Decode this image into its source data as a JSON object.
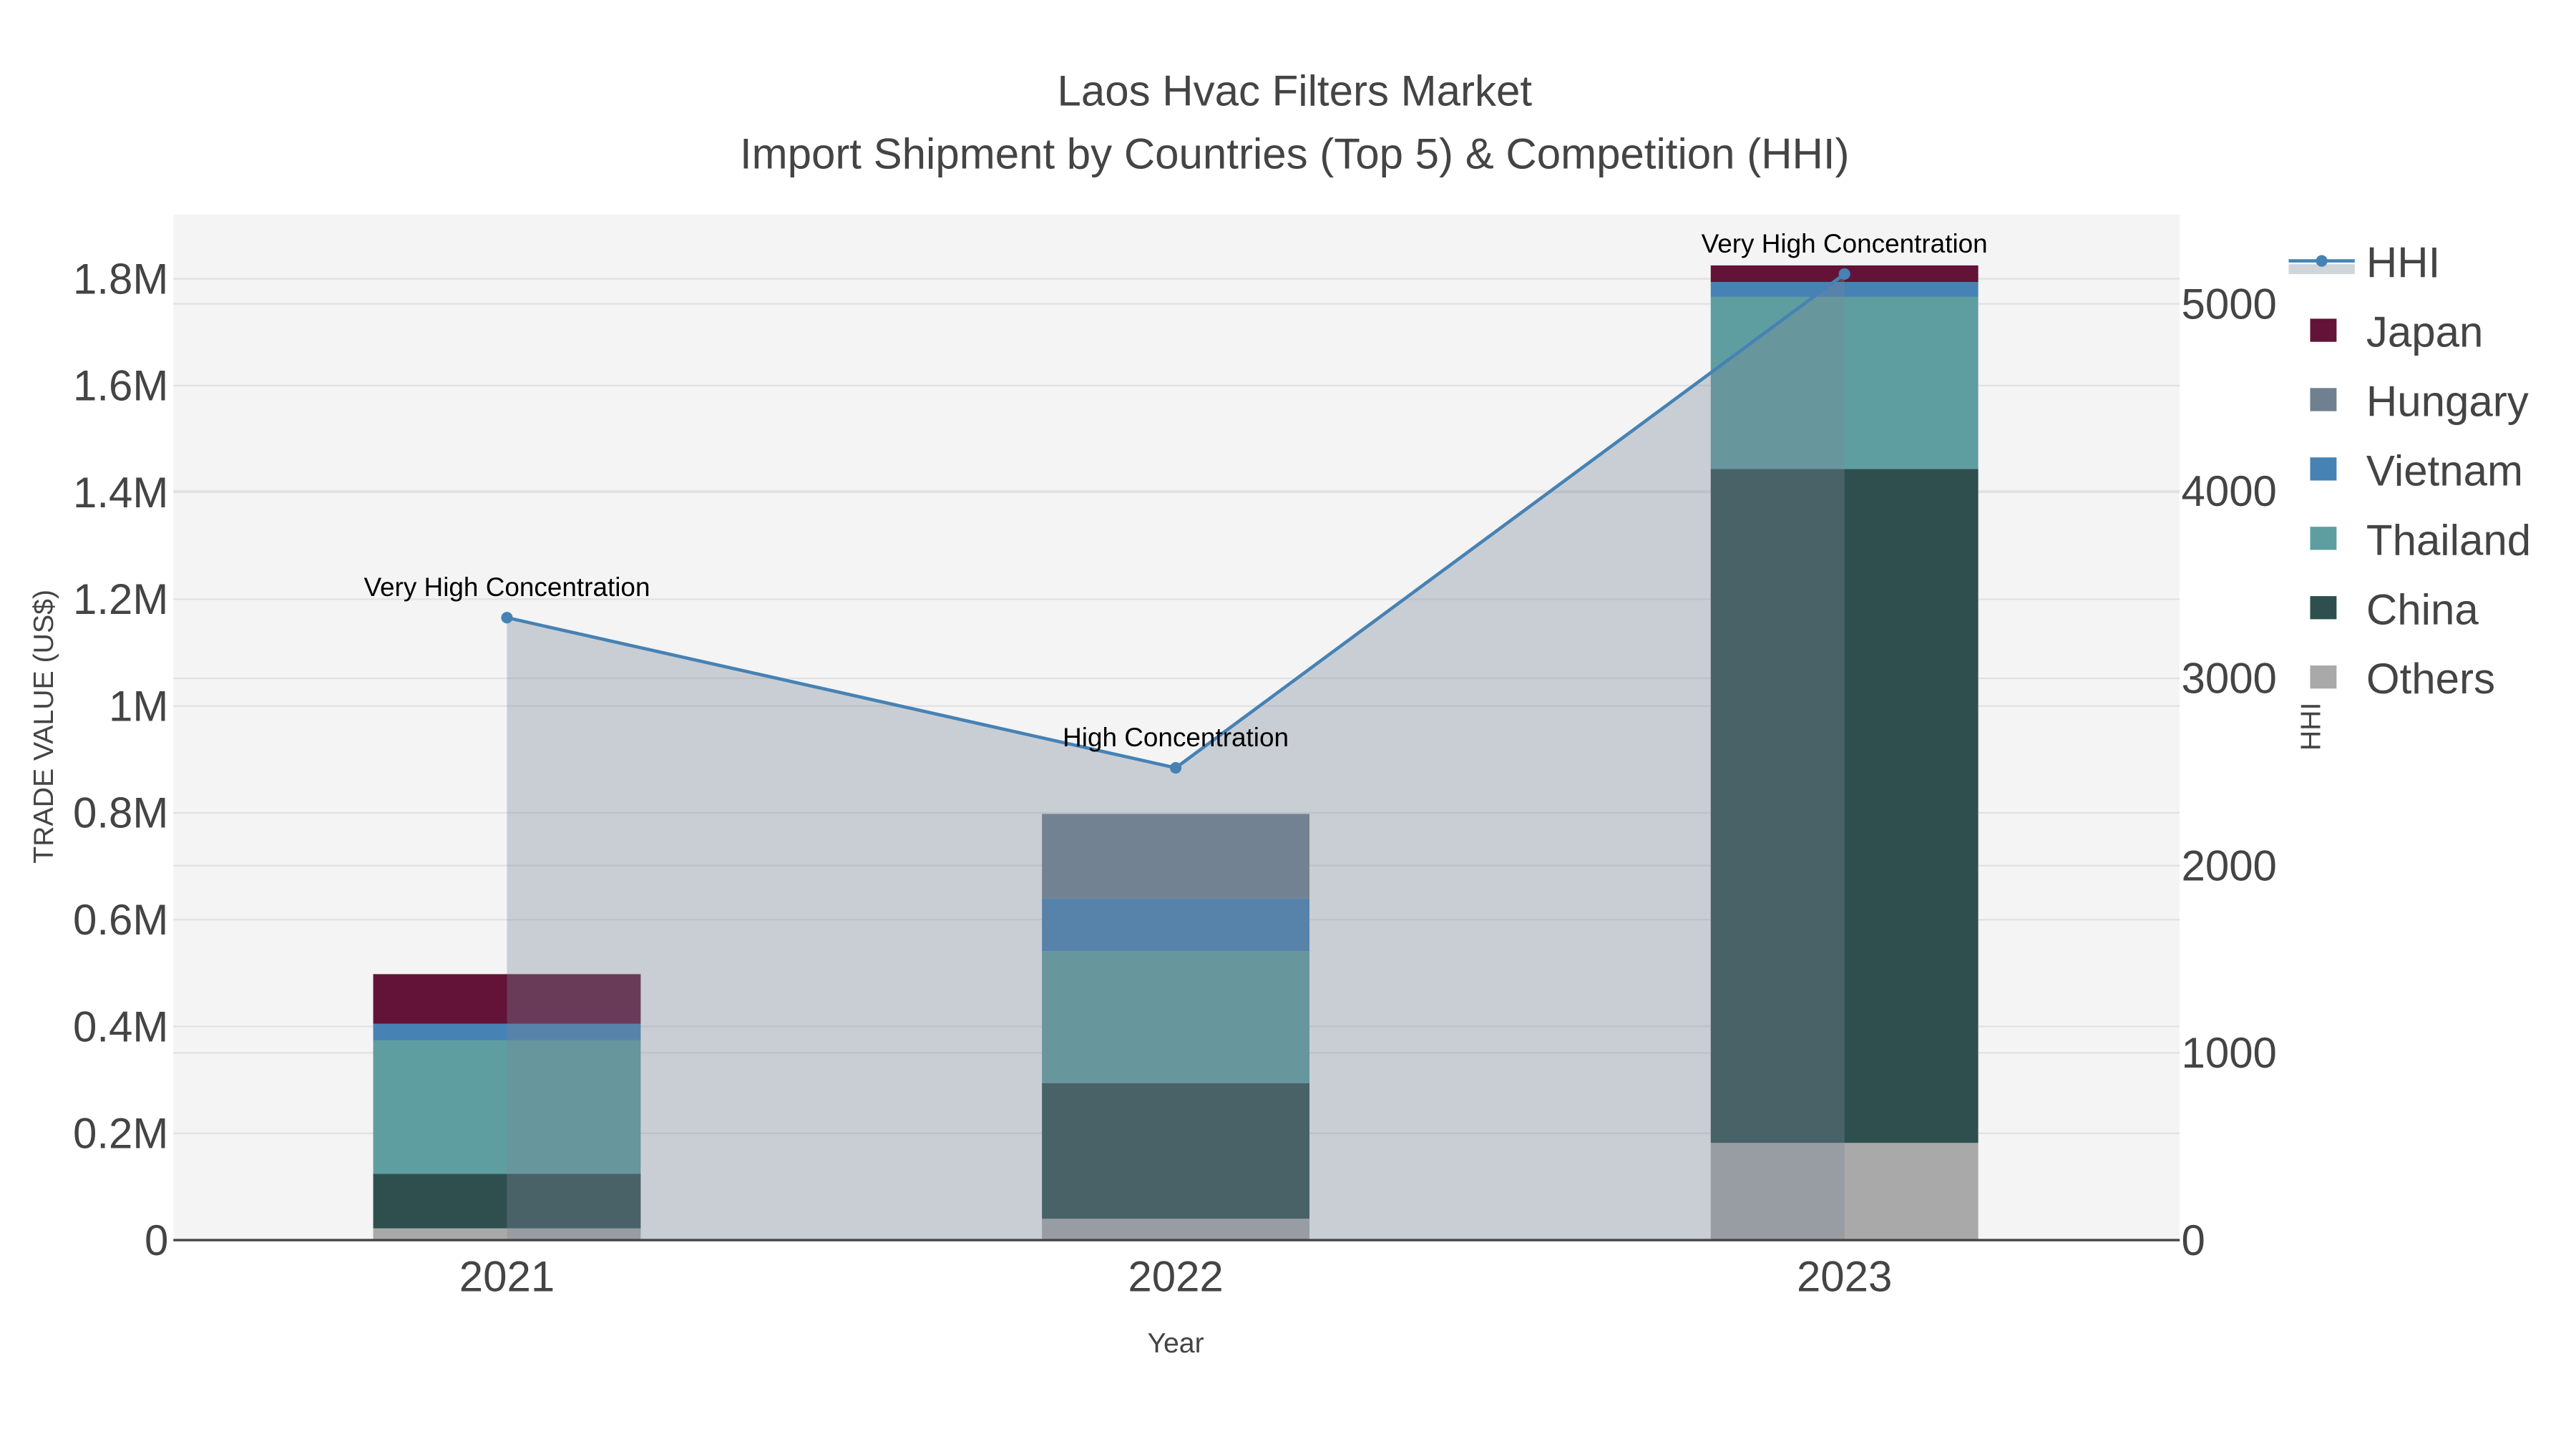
{
  "chart_data": {
    "type": "bar",
    "title": "Laos Hvac Filters Market",
    "subtitle": "Import Shipment by Countries (Top 5) & Competition (HHI)",
    "xlabel": "Year",
    "ylabel": "TRADE VALUE (US$)",
    "y2label": "HHI",
    "categories": [
      "2021",
      "2022",
      "2023"
    ],
    "ylim": [
      0,
      1920000
    ],
    "y2lim": [
      0,
      5476
    ],
    "yticks": [
      0,
      200000,
      400000,
      600000,
      800000,
      1000000,
      1200000,
      1400000,
      1600000,
      1800000
    ],
    "ytick_labels": [
      "0",
      "0.2M",
      "0.4M",
      "0.6M",
      "0.8M",
      "1M",
      "1.2M",
      "1.4M",
      "1.6M",
      "1.8M"
    ],
    "y2ticks": [
      0,
      1000,
      2000,
      3000,
      4000,
      5000
    ],
    "y2tick_labels": [
      "0",
      "1000",
      "2000",
      "3000",
      "4000",
      "5000"
    ],
    "grid": true,
    "stacked": true,
    "legend_position": "right",
    "series": [
      {
        "name": "Others",
        "color": "#a9a9a9",
        "values": [
          22000,
          40000,
          182000
        ]
      },
      {
        "name": "China",
        "color": "#2f4f4f",
        "values": [
          102000,
          254000,
          1262000
        ]
      },
      {
        "name": "Thailand",
        "color": "#5f9ea0",
        "values": [
          250000,
          247000,
          322000
        ]
      },
      {
        "name": "Vietnam",
        "color": "#4682b4",
        "values": [
          31000,
          99000,
          28000
        ]
      },
      {
        "name": "Hungary",
        "color": "#708090",
        "values": [
          0,
          158000,
          0
        ]
      },
      {
        "name": "Japan",
        "color": "#631337",
        "values": [
          93000,
          0,
          31000
        ]
      }
    ],
    "line": {
      "name": "HHI",
      "color": "#4682b4",
      "fill": "#778899",
      "values": [
        3324,
        2522,
        5159
      ],
      "annotations": [
        "Very High Concentration",
        "High Concentration",
        "Very High Concentration"
      ]
    },
    "legend_order": [
      "HHI",
      "Japan",
      "Hungary",
      "Vietnam",
      "Thailand",
      "China",
      "Others"
    ]
  }
}
